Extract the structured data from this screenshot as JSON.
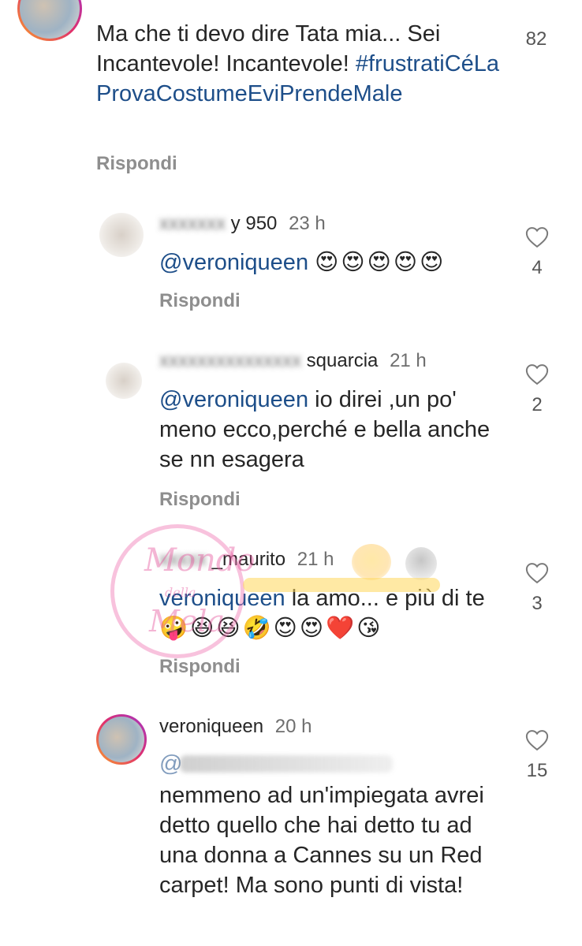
{
  "comments": [
    {
      "text": "Ma che ti devo dire Tata mia... Sei Incantevole! Incantevole!",
      "hashtag": "#frustratiCéLaProvaCostumeEviPrendeMale",
      "likes": "82",
      "reply": "Rispondi"
    },
    {
      "username_visible": "y 950",
      "time": "23 h",
      "mention": "@veroniqueen",
      "text": "😍😍😍😍😍",
      "likes": "4",
      "reply": "Rispondi"
    },
    {
      "username_visible": "squarcia",
      "time": "21 h",
      "mention": "@veroniqueen",
      "text": "io direi ,un po' meno ecco,perché e bella anche se nn esagera",
      "likes": "2",
      "reply": "Rispondi"
    },
    {
      "username_visible": "_maurito",
      "time": "21 h",
      "mention": "veroniqueen",
      "text": "la amo... e più di te",
      "emojis": "🤪😆😆🤣😍😍❤️😘",
      "likes": "3",
      "reply": "Rispondi"
    },
    {
      "username": "veroniqueen",
      "time": "20 h",
      "mention_prefix": "@",
      "text": "nemmeno ad un'impiegata avrei detto quello che hai detto tu ad una donna a Cannes su un Red carpet! Ma sono punti di vista!",
      "likes": "15"
    }
  ],
  "watermark": {
    "line1": "Mondo",
    "line2": "della",
    "line3": "Mela"
  },
  "colors": {
    "mention": "#1d4e89",
    "secondary": "#8e8e8e",
    "ring_start": "#f9a02a",
    "ring_end": "#a233c4"
  },
  "icons": {
    "like": "heart-outline-icon"
  }
}
